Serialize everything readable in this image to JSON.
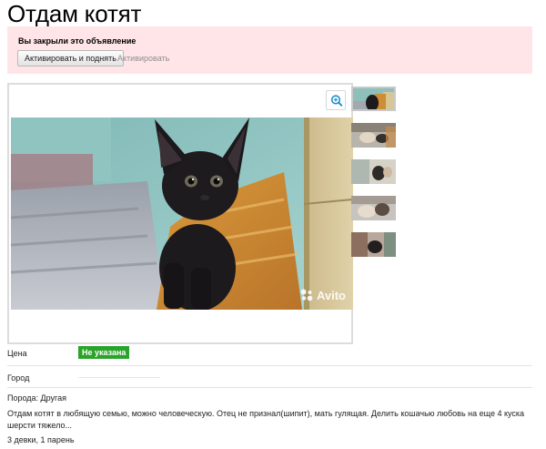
{
  "page": {
    "title": "Отдам котят"
  },
  "notice": {
    "text": "Вы закрыли это объявление",
    "activate_button": "Активировать и поднять",
    "activate_link": "Активировать"
  },
  "gallery": {
    "watermark": "Avito",
    "zoom_icon": "zoom-in-icon",
    "thumb_count": 5
  },
  "details": {
    "price_label": "Цена",
    "price_value": "Не указана",
    "city_label": "Город",
    "city_value": "",
    "breed": "Порода: Другая",
    "description": "Отдам котят в любящую семью, можно человеческую. Отец не признал(шипит), мать гулящая. Делить кошачью любовь на еще 4 куска шерсти тяжело...",
    "note": "3 девки, 1 парень"
  },
  "colors": {
    "banner_bg": "#ffe5e8",
    "price_badge": "#2aa32a",
    "accent_link": "#8e8e8e"
  }
}
